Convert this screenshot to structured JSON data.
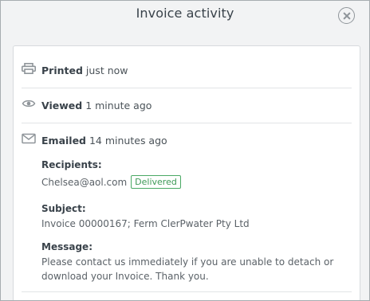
{
  "dialog": {
    "title": "Invoice activity"
  },
  "activity": {
    "printed": {
      "label": "Printed",
      "time": "just now",
      "icon": "printer-icon"
    },
    "viewed": {
      "label": "Viewed",
      "time": "1 minute ago",
      "icon": "eye-icon"
    },
    "emailed": {
      "label": "Emailed",
      "time": "14 minutes ago",
      "icon": "envelope-icon"
    }
  },
  "email_details": {
    "recipients_label": "Recipients:",
    "recipient": "Chelsea@aol.com",
    "status_badge": "Delivered",
    "subject_label": "Subject:",
    "subject": "Invoice 00000167; Ferm ClerPwater Pty Ltd",
    "message_label": "Message:",
    "message_line1": "Please contact us immediately if you are unable to detach or",
    "message_line2": "download your Invoice. Thank you."
  },
  "colors": {
    "badge_green": "#4aa964",
    "background": "#f2f3f4",
    "card": "#ffffff",
    "icon_gray": "#8f959a"
  }
}
